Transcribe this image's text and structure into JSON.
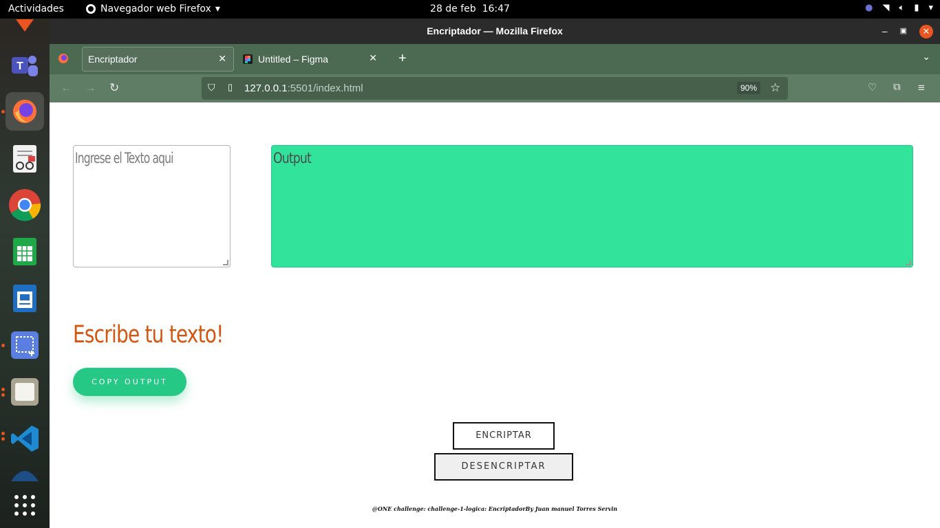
{
  "topbar": {
    "activities": "Actividades",
    "app_name": "Navegador web Firefox",
    "date": "28 de feb",
    "time": "16:47"
  },
  "dock": {
    "items": [
      "ubuntu-software-icon",
      "teams-icon",
      "firefox-icon",
      "document-viewer-icon",
      "chrome-icon",
      "calc-spreadsheet-icon",
      "writer-document-icon",
      "screenshot-icon",
      "files-icon",
      "vscode-icon",
      "app-icon",
      "show-apps-icon"
    ]
  },
  "window": {
    "title": "Encriptador — Mozilla Firefox"
  },
  "tabs": [
    {
      "label": "Encriptador",
      "active": true
    },
    {
      "label": "Untitled – Figma",
      "active": false
    }
  ],
  "navbar": {
    "url_host": "127.0.0.1",
    "url_path": ":5501/index.html",
    "zoom": "90%"
  },
  "page": {
    "input_placeholder": "Ingrese el Texto aqui",
    "output_placeholder": "Output",
    "heading": "Escribe tu texto!",
    "copy_label": "COPY OUTPUT",
    "encrypt_label": "ENCRIPTAR",
    "decrypt_label": "DESENCRIPTAR",
    "footer": "@ONE challenge: challenge-1-logica: EncriptadorBy Juan manuel Torres Servin"
  },
  "colors": {
    "output_bg": "#32e39b",
    "copy_bg": "#26c885",
    "heading": "#d5550f",
    "accent": "#e95420"
  }
}
